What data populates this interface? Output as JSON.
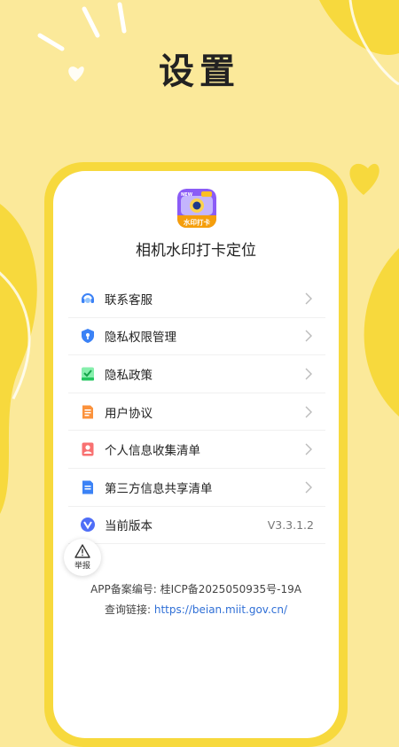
{
  "page": {
    "title": "设置"
  },
  "app": {
    "name": "相机水印打卡定位",
    "icon_badge": "水印打卡",
    "icon_new": "NEW"
  },
  "menu": {
    "items": [
      {
        "label": "联系客服",
        "icon": "headset-icon"
      },
      {
        "label": "隐私权限管理",
        "icon": "shield-icon"
      },
      {
        "label": "隐私政策",
        "icon": "policy-doc-icon"
      },
      {
        "label": "用户协议",
        "icon": "document-icon"
      },
      {
        "label": "个人信息收集清单",
        "icon": "person-card-icon"
      },
      {
        "label": "第三方信息共享清单",
        "icon": "share-list-icon"
      },
      {
        "label": "当前版本",
        "icon": "version-icon",
        "value": "V3.3.1.2"
      }
    ]
  },
  "report": {
    "label": "举报"
  },
  "footer": {
    "record_prefix": "APP备案编号:",
    "record_number": "桂ICP备2025050935号-19A",
    "query_prefix": "查询链接:",
    "query_link": "https://beian.miit.gov.cn/"
  },
  "colors": {
    "background": "#fbe99a",
    "frame": "#f7d93d",
    "link": "#2f6fd6"
  }
}
